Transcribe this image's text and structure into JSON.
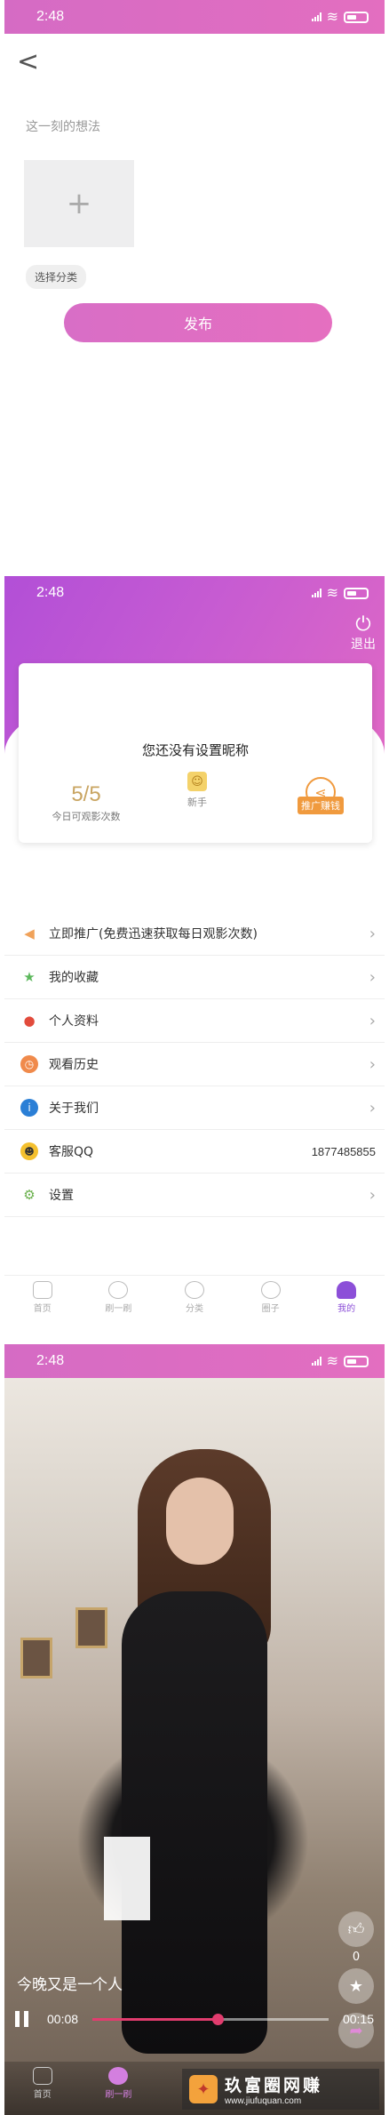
{
  "status": {
    "time": "2:48"
  },
  "post": {
    "back_label": "<",
    "prompt": "这一刻的想法",
    "add_symbol": "+",
    "category_label": "选择分类",
    "publish_label": "发布"
  },
  "profile": {
    "logout_label": "退出",
    "nickname": "您还没有设置昵称",
    "views": "5/5",
    "views_label": "今日可观影次数",
    "level": "新手",
    "share_label": "推广赚钱",
    "menu": [
      {
        "label": "立即推广(免费迅速获取每日观影次数)",
        "icon": "megaphone-icon",
        "color": "#f0a25a"
      },
      {
        "label": "我的收藏",
        "icon": "star-icon",
        "color": "#5cb85c"
      },
      {
        "label": "个人资料",
        "icon": "person-icon",
        "color": "#e24b3c"
      },
      {
        "label": "观看历史",
        "icon": "clock-icon",
        "color": "#f08a4b"
      },
      {
        "label": "关于我们",
        "icon": "info-icon",
        "color": "#2b7fd6"
      },
      {
        "label": "客服QQ",
        "icon": "qq-icon",
        "color": "#f4c02f",
        "value": "1877485855"
      },
      {
        "label": "设置",
        "icon": "gear-icon",
        "color": "#6ab04c"
      }
    ],
    "tabs": [
      "首页",
      "刷一刷",
      "分类",
      "圈子",
      "我的"
    ]
  },
  "video": {
    "title": "今晚又是一个人",
    "likes": "0",
    "current_time": "00:08",
    "total_time": "00:15",
    "progress": 0.53,
    "tabs": [
      "首页",
      "刷一刷"
    ],
    "watermark_cn": "玖富圈网赚",
    "watermark_url": "www.jiufuquan.com"
  }
}
